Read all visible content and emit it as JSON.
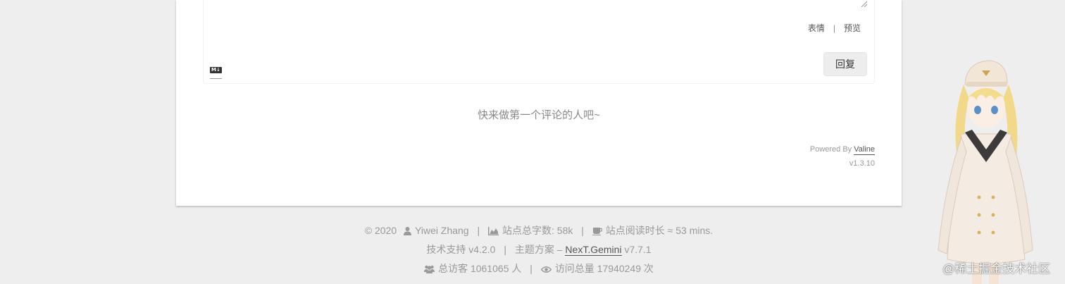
{
  "comment_box": {
    "tools": {
      "emoji": "表情",
      "divider": "|",
      "preview": "预览"
    },
    "markdown_badge": "M↓",
    "reply_button": "回复"
  },
  "comments": {
    "empty_message": "快来做第一个评论的人吧~"
  },
  "powered_by": {
    "prefix": "Powered By",
    "brand": "Valine",
    "version": "v1.3.10"
  },
  "footer": {
    "line1": {
      "copyright": "© 2020",
      "author": "Yiwei Zhang",
      "word_count": "站点总字数: 58k",
      "reading_time": "站点阅读时长 ≈ 53 mins."
    },
    "line2": {
      "tech_support": "技术支持 v4.2.0",
      "theme_prefix": "主题方案 –",
      "theme_link": "NexT.Gemini",
      "theme_version": "v7.7.1"
    },
    "line3": {
      "visitors": "总访客 1061065 人",
      "page_views": "访问总量 17940249 次"
    },
    "separator": "|"
  },
  "watermark": "@稀土掘金技术社区",
  "colors": {
    "page_bg": "#eeeeee",
    "card_bg": "#ffffff",
    "footer_text": "#999999",
    "link_text": "#555555"
  },
  "icons": {
    "author": "user-icon",
    "word_count": "area-chart-icon",
    "reading_time": "coffee-icon",
    "visitors": "users-icon",
    "page_views": "eye-icon"
  }
}
